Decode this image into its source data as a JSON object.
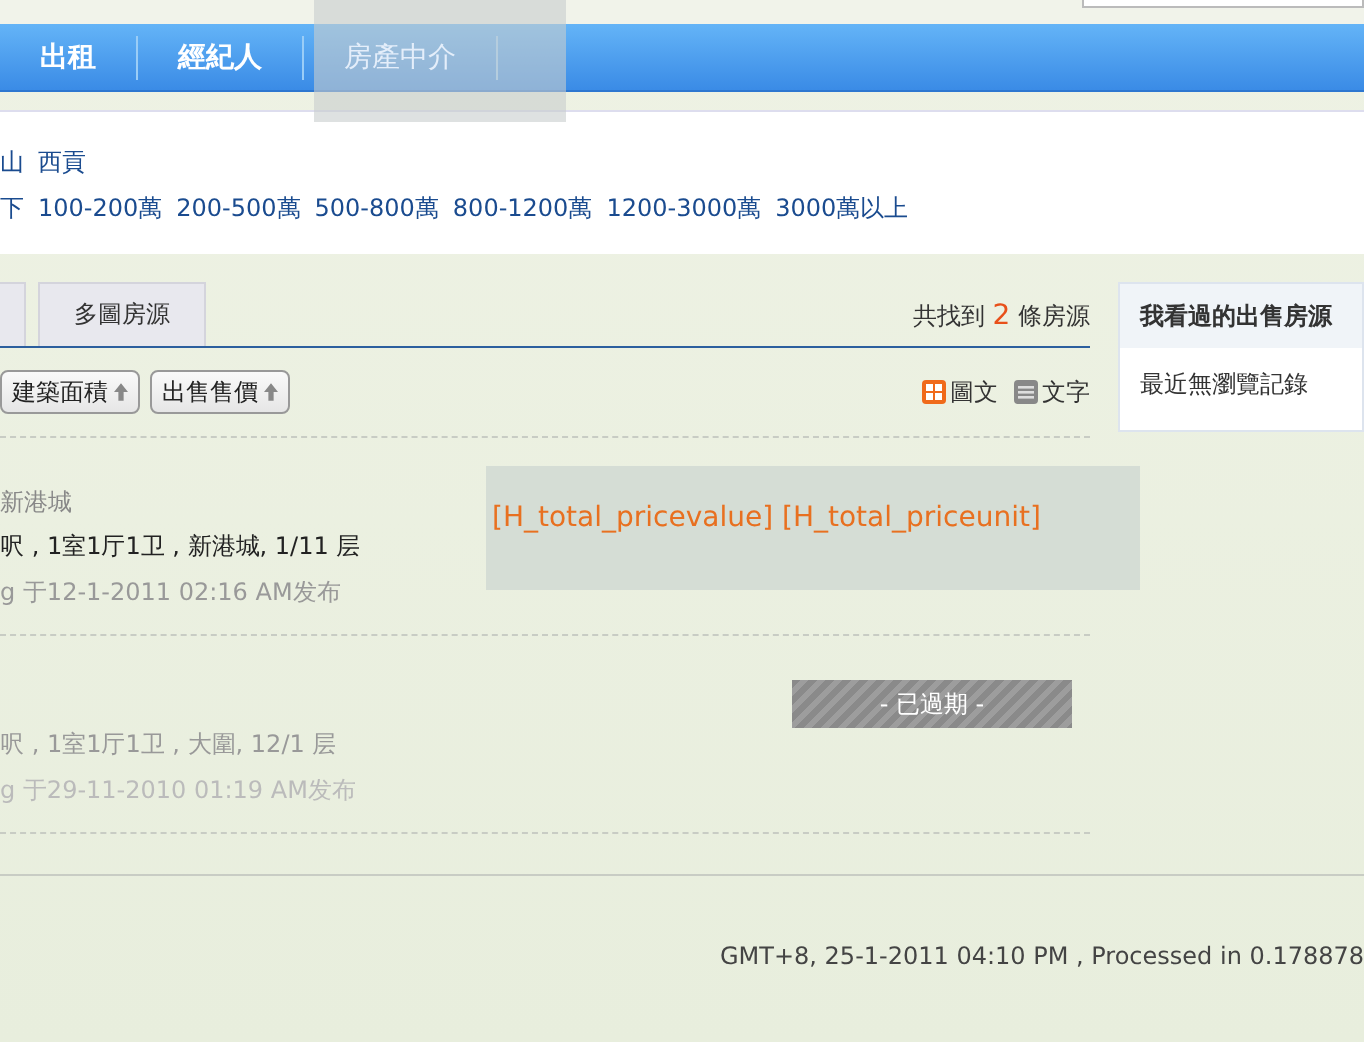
{
  "nav": {
    "items": [
      {
        "label": "出租",
        "hovered": false
      },
      {
        "label": "經紀人",
        "hovered": false
      },
      {
        "label": "房產中介",
        "hovered": true
      }
    ]
  },
  "filters": {
    "districts": [
      "山",
      "西貢"
    ],
    "prices": [
      "下",
      "100-200萬",
      "200-500萬",
      "500-800萬",
      "800-1200萬",
      "1200-3000萬",
      "3000萬以上"
    ]
  },
  "tabs": [
    {
      "label": "多圖房源"
    }
  ],
  "results": {
    "prefix": "共找到",
    "count": "2",
    "suffix": "條房源"
  },
  "sort_buttons": [
    "建築面積",
    "出售售價"
  ],
  "view_modes": [
    {
      "label": "圖文",
      "kind": "grid"
    },
    {
      "label": "文字",
      "kind": "list"
    }
  ],
  "listings": [
    {
      "title": "新港城",
      "detail": "呎 , 1室1厅1卫 , 新港城, 1/11 层",
      "meta": "g 于12-1-2011 02:16 AM发布",
      "expired": false,
      "price": "[H_total_pricevalue] [H_total_priceunit]"
    },
    {
      "detail": "呎 , 1室1厅1卫 , 大圍, 12/1 层",
      "meta": "g 于29-11-2010 01:19 AM发布",
      "expired": true,
      "status": "- 已過期 -"
    }
  ],
  "sidebar": {
    "title": "我看過的出售房源",
    "body": "最近無瀏覽記錄"
  },
  "footer": "GMT+8, 25-1-2011 04:10 PM , Processed in 0.178878"
}
